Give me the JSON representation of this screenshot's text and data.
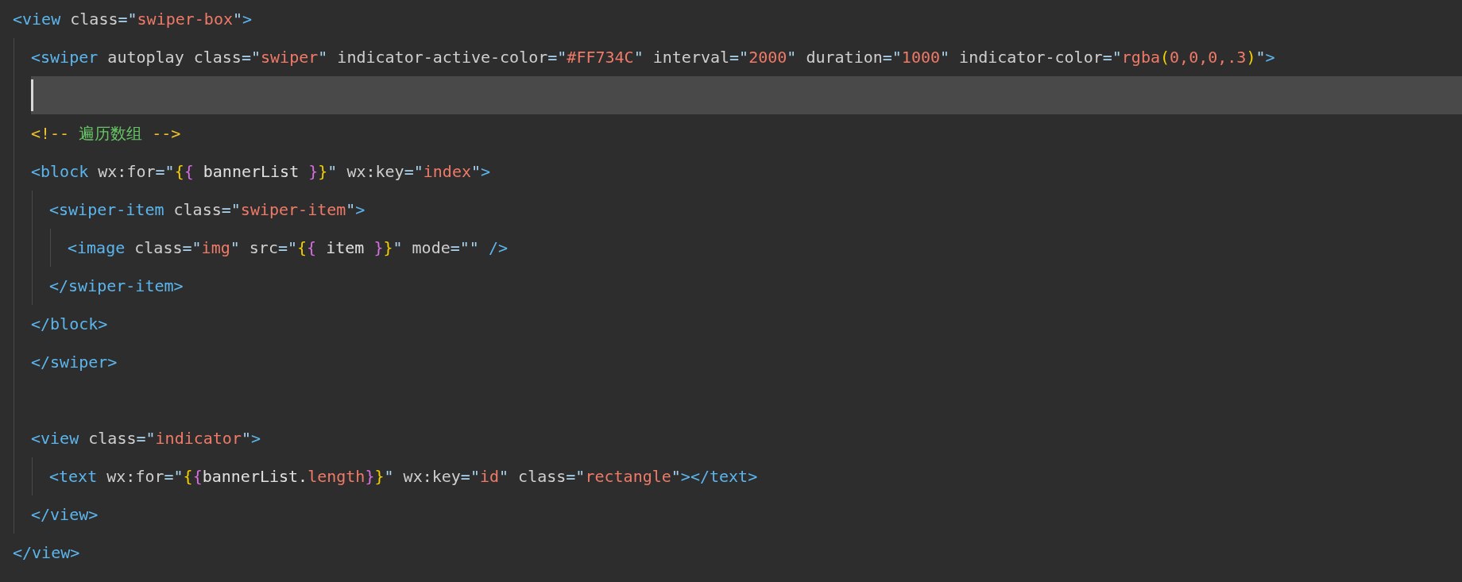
{
  "lines": [
    {
      "kind": "code",
      "current": false,
      "tokens": [
        {
          "text": "<view",
          "kind": "tag"
        },
        {
          "text": " class",
          "kind": "attr"
        },
        {
          "text": "=\"",
          "kind": "eq"
        },
        {
          "text": "swiper-box",
          "kind": "str"
        },
        {
          "text": "\"",
          "kind": "eq"
        },
        {
          "text": ">",
          "kind": "tag"
        }
      ],
      "children": [
        {
          "kind": "code",
          "current": false,
          "tokens": [
            {
              "text": "<swiper",
              "kind": "tag"
            },
            {
              "text": " autoplay class",
              "kind": "attr"
            },
            {
              "text": "=\"",
              "kind": "eq"
            },
            {
              "text": "swiper",
              "kind": "str"
            },
            {
              "text": "\"",
              "kind": "eq"
            },
            {
              "text": " indicator-active-color",
              "kind": "attr"
            },
            {
              "text": "=\"",
              "kind": "eq"
            },
            {
              "text": "#FF734C",
              "kind": "str"
            },
            {
              "text": "\"",
              "kind": "eq"
            },
            {
              "text": " interval",
              "kind": "attr"
            },
            {
              "text": "=\"",
              "kind": "eq"
            },
            {
              "text": "2000",
              "kind": "str"
            },
            {
              "text": "\"",
              "kind": "eq"
            },
            {
              "text": " duration",
              "kind": "attr"
            },
            {
              "text": "=\"",
              "kind": "eq"
            },
            {
              "text": "1000",
              "kind": "str"
            },
            {
              "text": "\"",
              "kind": "eq"
            },
            {
              "text": " indicator-color",
              "kind": "attr"
            },
            {
              "text": "=\"",
              "kind": "eq"
            },
            {
              "text": "rgba",
              "kind": "str"
            },
            {
              "text": "(",
              "kind": "brace1"
            },
            {
              "text": "0,0,0,.3",
              "kind": "str"
            },
            {
              "text": ")",
              "kind": "brace1"
            },
            {
              "text": "\"",
              "kind": "eq"
            },
            {
              "text": ">",
              "kind": "tag"
            }
          ]
        },
        {
          "kind": "blank",
          "current": true
        },
        {
          "kind": "code",
          "current": false,
          "tokens": [
            {
              "text": "<!--",
              "kind": "cmt"
            },
            {
              "text": " 遍历数组 ",
              "kind": "cmttext"
            },
            {
              "text": "-->",
              "kind": "cmt"
            }
          ]
        },
        {
          "kind": "code",
          "current": false,
          "tokens": [
            {
              "text": "<block",
              "kind": "tag"
            },
            {
              "text": " wx:for",
              "kind": "attr"
            },
            {
              "text": "=\"",
              "kind": "eq"
            },
            {
              "text": "{",
              "kind": "brace1"
            },
            {
              "text": "{",
              "kind": "brace2"
            },
            {
              "text": " bannerList ",
              "kind": "plain"
            },
            {
              "text": "}",
              "kind": "brace2"
            },
            {
              "text": "}",
              "kind": "brace1"
            },
            {
              "text": "\"",
              "kind": "eq"
            },
            {
              "text": " wx:key",
              "kind": "attr"
            },
            {
              "text": "=\"",
              "kind": "eq"
            },
            {
              "text": "index",
              "kind": "str"
            },
            {
              "text": "\"",
              "kind": "eq"
            },
            {
              "text": ">",
              "kind": "tag"
            }
          ],
          "children": [
            {
              "kind": "code",
              "current": false,
              "tokens": [
                {
                  "text": "<swiper-item",
                  "kind": "tag"
                },
                {
                  "text": " class",
                  "kind": "attr"
                },
                {
                  "text": "=\"",
                  "kind": "eq"
                },
                {
                  "text": "swiper-item",
                  "kind": "str"
                },
                {
                  "text": "\"",
                  "kind": "eq"
                },
                {
                  "text": ">",
                  "kind": "tag"
                }
              ],
              "children": [
                {
                  "kind": "code",
                  "current": false,
                  "tokens": [
                    {
                      "text": "<image",
                      "kind": "tag"
                    },
                    {
                      "text": " class",
                      "kind": "attr"
                    },
                    {
                      "text": "=\"",
                      "kind": "eq"
                    },
                    {
                      "text": "img",
                      "kind": "str"
                    },
                    {
                      "text": "\"",
                      "kind": "eq"
                    },
                    {
                      "text": " src",
                      "kind": "attr"
                    },
                    {
                      "text": "=\"",
                      "kind": "eq"
                    },
                    {
                      "text": "{",
                      "kind": "brace1"
                    },
                    {
                      "text": "{",
                      "kind": "brace2"
                    },
                    {
                      "text": " item ",
                      "kind": "plain"
                    },
                    {
                      "text": "}",
                      "kind": "brace2"
                    },
                    {
                      "text": "}",
                      "kind": "brace1"
                    },
                    {
                      "text": "\"",
                      "kind": "eq"
                    },
                    {
                      "text": " mode",
                      "kind": "attr"
                    },
                    {
                      "text": "=\"\"",
                      "kind": "eq"
                    },
                    {
                      "text": " />",
                      "kind": "tag"
                    }
                  ]
                }
              ]
            },
            {
              "kind": "code",
              "current": false,
              "tokens": [
                {
                  "text": "</swiper-item>",
                  "kind": "tag"
                }
              ]
            }
          ]
        },
        {
          "kind": "code",
          "current": false,
          "tokens": [
            {
              "text": "</block>",
              "kind": "tag"
            }
          ]
        },
        {
          "kind": "code",
          "current": false,
          "tokens": [
            {
              "text": "</swiper>",
              "kind": "tag"
            }
          ]
        },
        {
          "kind": "blank"
        },
        {
          "kind": "code",
          "current": false,
          "tokens": [
            {
              "text": "<view",
              "kind": "tag"
            },
            {
              "text": " class",
              "kind": "attr"
            },
            {
              "text": "=\"",
              "kind": "eq"
            },
            {
              "text": "indicator",
              "kind": "str"
            },
            {
              "text": "\"",
              "kind": "eq"
            },
            {
              "text": ">",
              "kind": "tag"
            }
          ],
          "children": [
            {
              "kind": "code",
              "current": false,
              "tokens": [
                {
                  "text": "<text",
                  "kind": "tag"
                },
                {
                  "text": " wx:for",
                  "kind": "attr"
                },
                {
                  "text": "=\"",
                  "kind": "eq"
                },
                {
                  "text": "{",
                  "kind": "brace1"
                },
                {
                  "text": "{",
                  "kind": "brace2"
                },
                {
                  "text": "bannerList.",
                  "kind": "plain"
                },
                {
                  "text": "length",
                  "kind": "str"
                },
                {
                  "text": "}",
                  "kind": "brace2"
                },
                {
                  "text": "}",
                  "kind": "brace1"
                },
                {
                  "text": "\"",
                  "kind": "eq"
                },
                {
                  "text": " wx:key",
                  "kind": "attr"
                },
                {
                  "text": "=\"",
                  "kind": "eq"
                },
                {
                  "text": "id",
                  "kind": "str"
                },
                {
                  "text": "\"",
                  "kind": "eq"
                },
                {
                  "text": " class",
                  "kind": "attr"
                },
                {
                  "text": "=\"",
                  "kind": "eq"
                },
                {
                  "text": "rectangle",
                  "kind": "str"
                },
                {
                  "text": "\"",
                  "kind": "eq"
                },
                {
                  "text": "></text>",
                  "kind": "tag"
                }
              ]
            }
          ]
        },
        {
          "kind": "code",
          "current": false,
          "tokens": [
            {
              "text": "</view>",
              "kind": "tag"
            }
          ]
        }
      ]
    },
    {
      "kind": "code",
      "current": false,
      "tokens": [
        {
          "text": "</view>",
          "kind": "tag"
        }
      ]
    }
  ]
}
